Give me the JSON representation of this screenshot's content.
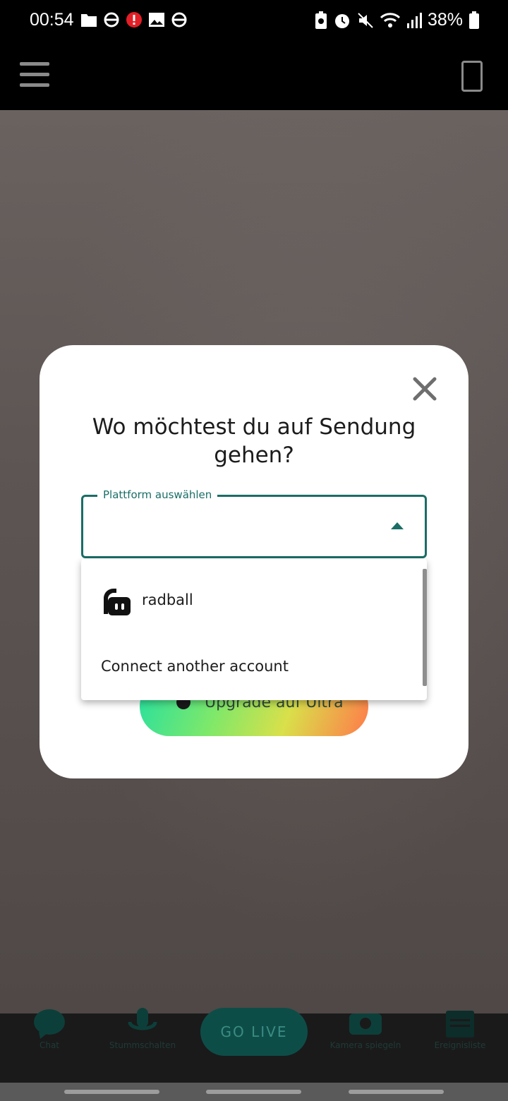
{
  "status_bar": {
    "time": "00:54",
    "battery_pct": "38%"
  },
  "modal": {
    "title": "Wo möchtest du auf Sendung gehen?",
    "select_label": "Plattform auswählen",
    "upgrade_label": "Upgrade auf Ultra"
  },
  "dropdown": {
    "items": [
      {
        "label": "radball",
        "icon": "streamlabs-icon"
      },
      {
        "label": "Connect another account"
      }
    ]
  },
  "bottom_nav": {
    "chat": "Chat",
    "mute": "Stummschalten",
    "go_live": "GO LIVE",
    "flip_camera": "Kamera spiegeln",
    "events": "Ereignisliste"
  },
  "colors": {
    "accent": "#1a6e66",
    "go_live_bg": "#0d4d48"
  }
}
